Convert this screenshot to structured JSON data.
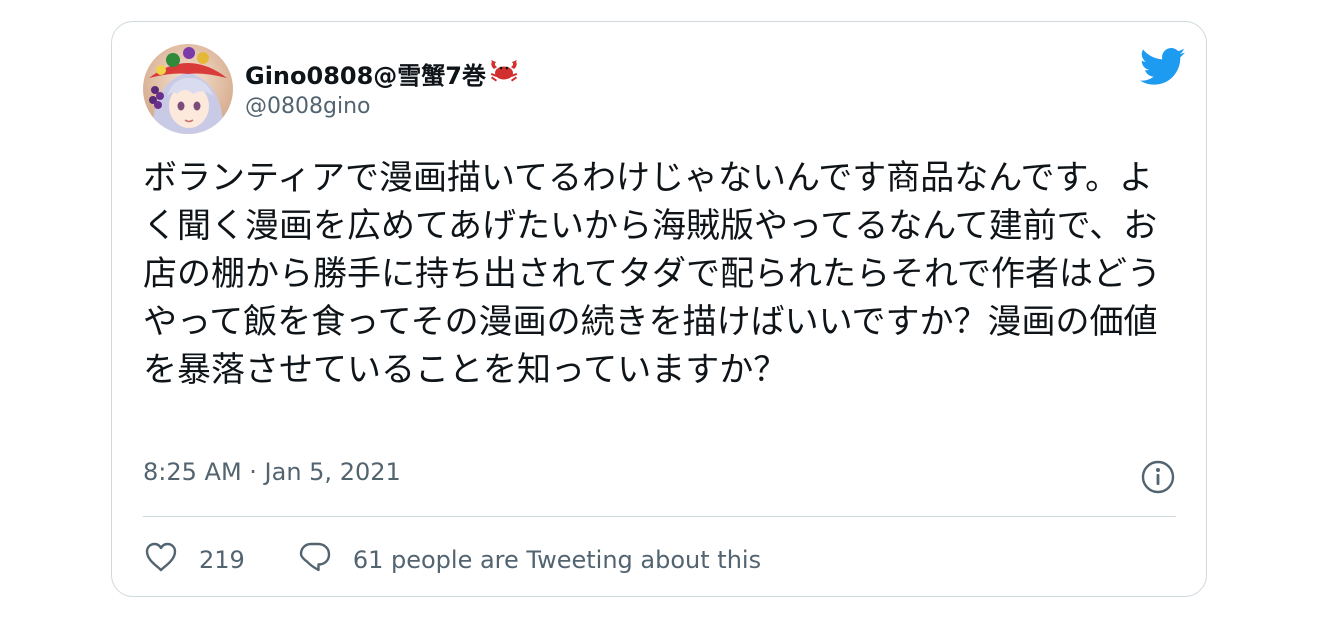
{
  "tweet": {
    "author": {
      "display_name": "Gino0808@雪蟹7巻",
      "emoji": "🦀",
      "handle": "@0808gino"
    },
    "text": "ボランティアで漫画描いてるわけじゃないんです商品なんです。よく聞く漫画を広めてあげたいから海賊版やってるなんて建前で、お店の棚から勝手に持ち出されてタダで配られたらそれで作者はどうやって飯を食ってその漫画の続きを描けばいいですか？漫画の価値を暴落させていることを知っていますか？",
    "timestamp": "8:25 AM · Jan 5, 2021",
    "likes": "219",
    "conversation": "61 people are Tweeting about this"
  },
  "icons": {
    "logo": "twitter-bird-icon",
    "info": "info-circle-icon",
    "like": "heart-outline-icon",
    "reply": "speech-bubble-icon"
  },
  "colors": {
    "brand": "#1d9bf0",
    "text": "#0f1419",
    "muted": "#536471",
    "border": "#cfd9de"
  }
}
